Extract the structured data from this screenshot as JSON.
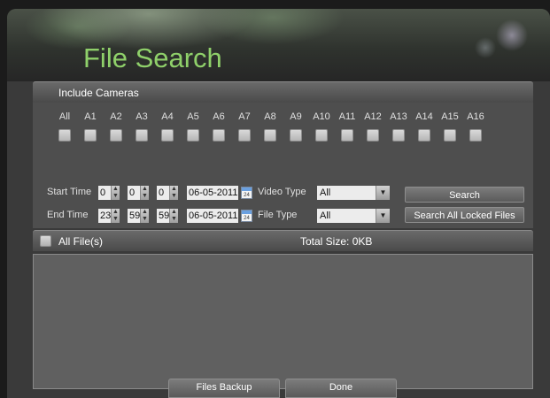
{
  "title": "File Search",
  "cameras": {
    "header": "Include Cameras",
    "items": [
      "All",
      "A1",
      "A2",
      "A3",
      "A4",
      "A5",
      "A6",
      "A7",
      "A8",
      "A9",
      "A10",
      "A11",
      "A12",
      "A13",
      "A14",
      "A15",
      "A16"
    ]
  },
  "start_time": {
    "label": "Start Time",
    "hour": "0",
    "minute": "0",
    "second": "0",
    "date": "06-05-2011"
  },
  "end_time": {
    "label": "End Time",
    "hour": "23",
    "minute": "59",
    "second": "59",
    "date": "06-05-2011"
  },
  "video_type": {
    "label": "Video Type",
    "value": "All"
  },
  "file_type": {
    "label": "File Type",
    "value": "All"
  },
  "buttons": {
    "search": "Search",
    "search_locked": "Search All Locked Files",
    "backup": "Files Backup",
    "done": "Done"
  },
  "files": {
    "all_label": "All File(s)",
    "total_size": "Total Size: 0KB"
  },
  "icons": {
    "calendar": "calendar-icon",
    "spinner": "spinner-arrows-icon",
    "dropdown": "dropdown-arrow-icon"
  },
  "colors": {
    "title": "#8fd06a",
    "panel": "#4e4e4e",
    "bar": "#5a5a5a"
  }
}
